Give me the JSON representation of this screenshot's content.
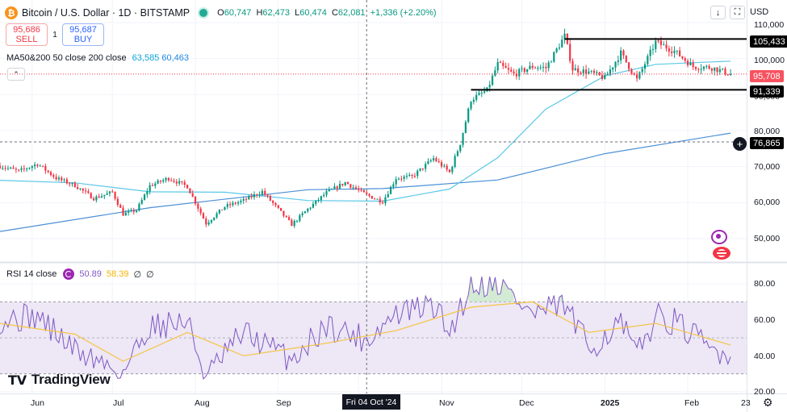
{
  "header": {
    "logo_glyph": "₿",
    "symbol": "Bitcoin / U.S. Dollar · 1D · BITSTAMP",
    "o_label": "O",
    "o": "60,747",
    "h_label": "H",
    "h": "62,473",
    "l_label": "L",
    "l": "60,474",
    "c_label": "C",
    "c": "62,081",
    "change": "+1,336 (+2.20%)"
  },
  "trade": {
    "sell_price": "95,686",
    "sell_label": "SELL",
    "spread": "1",
    "buy_price": "95,687",
    "buy_label": "BUY"
  },
  "ma_legend": {
    "name": "MA50&200 50 close 200 close",
    "ma50": "63,585",
    "ma200": "60,463"
  },
  "rsi_legend": {
    "name": "RSI 14 close",
    "rsi": "50.89",
    "ma": "58.39",
    "extra1": "∅",
    "extra2": "∅"
  },
  "toolbar": {
    "download_icon": "↓",
    "fullscreen_icon": "⛶",
    "currency": "USD"
  },
  "collapse_icon": "⌃",
  "price_axis": [
    "110,000",
    "100,000",
    "90,000",
    "80,000",
    "70,000",
    "60,000",
    "50,000"
  ],
  "rsi_axis": [
    "80.00",
    "60.00",
    "40.00",
    "20.00"
  ],
  "time_axis": [
    "Jun",
    "Jul",
    "Aug",
    "Sep",
    "Nov",
    "Dec",
    "2025",
    "Feb",
    "23"
  ],
  "crosshair_date": "Fri 04 Oct '24",
  "tags": {
    "resistance": "105,433",
    "last_price": "95,708",
    "support": "91,339",
    "crosshair_price": "76,865"
  },
  "plus_glyph": "+",
  "settings_icon": "⚙",
  "brand": {
    "mark": "TV",
    "name": "TradingView"
  },
  "colors": {
    "up": "#089981",
    "down": "#f23645",
    "ma50": "#5bc8e8",
    "ma200": "#4a8fd6",
    "rsi": "#7e57c2",
    "rsi_ma": "#f4c542",
    "rsi_band": "#ede7f6"
  },
  "chart_data": [
    {
      "type": "candlestick",
      "title": "Bitcoin / U.S. Dollar · 1D · BITSTAMP",
      "x_range": [
        "2024-05-20",
        "2025-02-23"
      ],
      "ylim": [
        45000,
        112000
      ],
      "y_ticks": [
        50000,
        60000,
        70000,
        80000,
        90000,
        100000,
        110000
      ],
      "close_path": {
        "dates": [
          "2024-05-20",
          "2024-05-27",
          "2024-06-03",
          "2024-06-10",
          "2024-06-17",
          "2024-06-24",
          "2024-07-01",
          "2024-07-05",
          "2024-07-10",
          "2024-07-15",
          "2024-07-22",
          "2024-07-29",
          "2024-08-05",
          "2024-08-12",
          "2024-08-19",
          "2024-08-26",
          "2024-09-02",
          "2024-09-06",
          "2024-09-12",
          "2024-09-19",
          "2024-09-26",
          "2024-10-04",
          "2024-10-10",
          "2024-10-15",
          "2024-10-21",
          "2024-10-29",
          "2024-11-04",
          "2024-11-08",
          "2024-11-12",
          "2024-11-18",
          "2024-11-22",
          "2024-11-28",
          "2024-12-05",
          "2024-12-10",
          "2024-12-17",
          "2024-12-20",
          "2024-12-26",
          "2025-01-01",
          "2025-01-07",
          "2025-01-13",
          "2025-01-20",
          "2025-01-27",
          "2025-02-03",
          "2025-02-10",
          "2025-02-17"
        ],
        "close": [
          70200,
          68700,
          70800,
          66800,
          64800,
          61200,
          62900,
          56800,
          57900,
          64700,
          66800,
          64500,
          54200,
          58900,
          60600,
          63100,
          57300,
          53900,
          58200,
          62800,
          65600,
          62100,
          60300,
          66800,
          67200,
          72300,
          68400,
          76500,
          88600,
          91200,
          98500,
          95600,
          97800,
          97400,
          106300,
          97100,
          96200,
          94600,
          101500,
          94100,
          104600,
          102100,
          97800,
          97500,
          95700
        ]
      },
      "ma50": {
        "dates": [
          "2024-05-20",
          "2024-06-17",
          "2024-07-15",
          "2024-08-12",
          "2024-09-12",
          "2024-10-10",
          "2024-11-04",
          "2024-11-22",
          "2024-12-10",
          "2025-01-01",
          "2025-01-20",
          "2025-02-17"
        ],
        "values": [
          66200,
          65500,
          63000,
          62900,
          60600,
          60400,
          63800,
          72500,
          86000,
          95200,
          98400,
          99300
        ]
      },
      "ma200": {
        "dates": [
          "2024-05-20",
          "2024-07-15",
          "2024-09-12",
          "2024-10-10",
          "2024-11-22",
          "2025-01-01",
          "2025-02-17"
        ],
        "values": [
          52000,
          58600,
          63600,
          63900,
          66300,
          73600,
          79300
        ]
      },
      "levels": {
        "resistance": 105433,
        "support": 91339,
        "last": 95708,
        "crosshair": 76865
      }
    },
    {
      "type": "line",
      "title": "RSI 14 close",
      "ylim": [
        20,
        86
      ],
      "y_ticks": [
        20,
        40,
        60,
        80
      ],
      "bands": {
        "upper": 70,
        "middle": 50,
        "lower": 30
      },
      "series": [
        {
          "name": "RSI",
          "dates": [
            "2024-05-20",
            "2024-06-03",
            "2024-06-17",
            "2024-07-05",
            "2024-07-15",
            "2024-07-29",
            "2024-08-05",
            "2024-08-19",
            "2024-09-06",
            "2024-09-19",
            "2024-10-04",
            "2024-10-15",
            "2024-10-29",
            "2024-11-04",
            "2024-11-12",
            "2024-11-22",
            "2024-12-05",
            "2024-12-17",
            "2024-12-26",
            "2025-01-07",
            "2025-01-13",
            "2025-01-20",
            "2025-01-27",
            "2025-02-10",
            "2025-02-17"
          ],
          "values": [
            60,
            62,
            43,
            31,
            57,
            59,
            28,
            53,
            38,
            57,
            49,
            63,
            68,
            53,
            80,
            81,
            63,
            68,
            44,
            58,
            40,
            62,
            59,
            43,
            42
          ]
        },
        {
          "name": "RSI MA",
          "dates": [
            "2024-05-20",
            "2024-06-17",
            "2024-07-05",
            "2024-07-29",
            "2024-08-19",
            "2024-09-19",
            "2024-10-15",
            "2024-11-12",
            "2024-12-05",
            "2024-12-26",
            "2025-01-20",
            "2025-02-17"
          ],
          "values": [
            58,
            52,
            37,
            53,
            40,
            47,
            54,
            67,
            70,
            53,
            58,
            46
          ]
        }
      ]
    }
  ]
}
